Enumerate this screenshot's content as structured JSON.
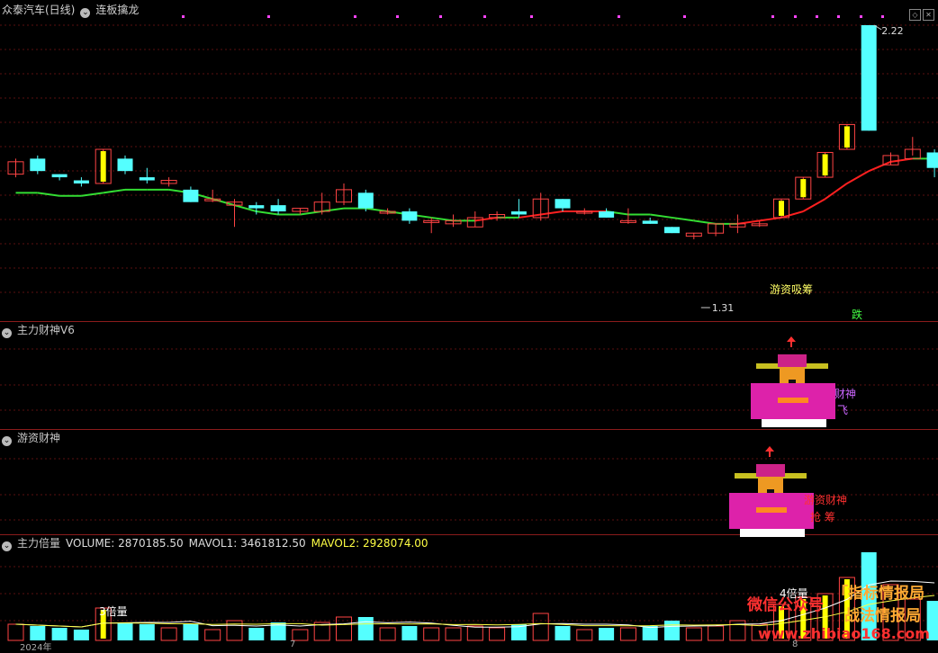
{
  "header": {
    "stock": "众泰汽车(日线)",
    "indicator": "连板擒龙"
  },
  "main": {
    "high_label": "2.22",
    "low_label": "1.31",
    "annotation": "游资吸筹",
    "fall_label": "跌"
  },
  "panel2": {
    "title": "主力财神V6",
    "label_a": "财神",
    "label_b": "飞"
  },
  "panel3": {
    "title": "游资财神",
    "label_a": "游资财神",
    "label_b": "抢 筹"
  },
  "panel4": {
    "title": "主力倍量",
    "volume": "VOLUME: 2870185.50",
    "mavol1": "MAVOL1: 3461812.50",
    "mavol2": "MAVOL2: 2928074.00",
    "label_a": "3倍量",
    "label_b": "4倍量"
  },
  "axis": {
    "year": "2024年",
    "m1": "7",
    "m2": "8"
  },
  "watermark": {
    "line1": "微信公众号",
    "line2": "「指标情报局",
    "line3": "战法情报局",
    "site": "www.zhibiao168.com"
  },
  "colors": {
    "up": "#ff4444",
    "down": "#54ffff",
    "ma_up": "#ff2020",
    "ma_down": "#33dd33",
    "limit": "#ffff00"
  },
  "chart_data": {
    "type": "candlestick",
    "price_range": [
      1.31,
      2.22
    ],
    "candles": [
      {
        "o": 1.78,
        "c": 1.74,
        "h": 1.79,
        "l": 1.73,
        "d": "up"
      },
      {
        "o": 1.79,
        "c": 1.75,
        "h": 1.8,
        "l": 1.74,
        "d": "down"
      },
      {
        "o": 1.74,
        "c": 1.73,
        "h": 1.74,
        "l": 1.72,
        "d": "down"
      },
      {
        "o": 1.72,
        "c": 1.71,
        "h": 1.73,
        "l": 1.7,
        "d": "down"
      },
      {
        "o": 1.71,
        "c": 1.82,
        "h": 1.82,
        "l": 1.71,
        "d": "limit"
      },
      {
        "o": 1.79,
        "c": 1.75,
        "h": 1.8,
        "l": 1.74,
        "d": "down"
      },
      {
        "o": 1.73,
        "c": 1.72,
        "h": 1.76,
        "l": 1.71,
        "d": "down"
      },
      {
        "o": 1.71,
        "c": 1.72,
        "h": 1.73,
        "l": 1.7,
        "d": "up"
      },
      {
        "o": 1.69,
        "c": 1.65,
        "h": 1.7,
        "l": 1.65,
        "d": "down"
      },
      {
        "o": 1.66,
        "c": 1.66,
        "h": 1.69,
        "l": 1.65,
        "d": "up"
      },
      {
        "o": 1.65,
        "c": 1.64,
        "h": 1.66,
        "l": 1.57,
        "d": "up"
      },
      {
        "o": 1.64,
        "c": 1.63,
        "h": 1.65,
        "l": 1.61,
        "d": "down"
      },
      {
        "o": 1.64,
        "c": 1.62,
        "h": 1.66,
        "l": 1.61,
        "d": "down"
      },
      {
        "o": 1.62,
        "c": 1.63,
        "h": 1.63,
        "l": 1.61,
        "d": "up"
      },
      {
        "o": 1.62,
        "c": 1.65,
        "h": 1.68,
        "l": 1.61,
        "d": "up"
      },
      {
        "o": 1.65,
        "c": 1.69,
        "h": 1.71,
        "l": 1.64,
        "d": "up"
      },
      {
        "o": 1.68,
        "c": 1.63,
        "h": 1.69,
        "l": 1.62,
        "d": "down"
      },
      {
        "o": 1.62,
        "c": 1.62,
        "h": 1.63,
        "l": 1.61,
        "d": "up"
      },
      {
        "o": 1.62,
        "c": 1.59,
        "h": 1.63,
        "l": 1.58,
        "d": "down"
      },
      {
        "o": 1.59,
        "c": 1.59,
        "h": 1.6,
        "l": 1.55,
        "d": "up"
      },
      {
        "o": 1.58,
        "c": 1.59,
        "h": 1.61,
        "l": 1.57,
        "d": "up"
      },
      {
        "o": 1.57,
        "c": 1.6,
        "h": 1.62,
        "l": 1.57,
        "d": "up"
      },
      {
        "o": 1.6,
        "c": 1.61,
        "h": 1.62,
        "l": 1.59,
        "d": "up"
      },
      {
        "o": 1.62,
        "c": 1.61,
        "h": 1.66,
        "l": 1.6,
        "d": "down"
      },
      {
        "o": 1.6,
        "c": 1.66,
        "h": 1.68,
        "l": 1.59,
        "d": "up"
      },
      {
        "o": 1.66,
        "c": 1.63,
        "h": 1.66,
        "l": 1.62,
        "d": "down"
      },
      {
        "o": 1.62,
        "c": 1.62,
        "h": 1.63,
        "l": 1.61,
        "d": "up"
      },
      {
        "o": 1.62,
        "c": 1.6,
        "h": 1.63,
        "l": 1.6,
        "d": "down"
      },
      {
        "o": 1.59,
        "c": 1.59,
        "h": 1.63,
        "l": 1.58,
        "d": "up"
      },
      {
        "o": 1.59,
        "c": 1.58,
        "h": 1.6,
        "l": 1.58,
        "d": "down"
      },
      {
        "o": 1.57,
        "c": 1.55,
        "h": 1.57,
        "l": 1.55,
        "d": "down"
      },
      {
        "o": 1.55,
        "c": 1.54,
        "h": 1.55,
        "l": 1.53,
        "d": "up"
      },
      {
        "o": 1.55,
        "c": 1.58,
        "h": 1.58,
        "l": 1.54,
        "d": "up"
      },
      {
        "o": 1.57,
        "c": 1.58,
        "h": 1.61,
        "l": 1.55,
        "d": "up"
      },
      {
        "o": 1.58,
        "c": 1.58,
        "h": 1.59,
        "l": 1.57,
        "d": "up"
      },
      {
        "o": 1.6,
        "c": 1.66,
        "h": 1.66,
        "l": 1.6,
        "d": "limit"
      },
      {
        "o": 1.66,
        "c": 1.73,
        "h": 1.73,
        "l": 1.66,
        "d": "limit"
      },
      {
        "o": 1.73,
        "c": 1.81,
        "h": 1.81,
        "l": 1.73,
        "d": "limit"
      },
      {
        "o": 1.82,
        "c": 1.9,
        "h": 1.9,
        "l": 1.82,
        "d": "limit"
      },
      {
        "o": 2.22,
        "c": 1.88,
        "h": 2.22,
        "l": 1.88,
        "d": "down"
      },
      {
        "o": 1.77,
        "c": 1.8,
        "h": 1.81,
        "l": 1.77,
        "d": "up"
      },
      {
        "o": 1.79,
        "c": 1.82,
        "h": 1.86,
        "l": 1.8,
        "d": "up"
      },
      {
        "o": 1.81,
        "c": 1.76,
        "h": 1.82,
        "l": 1.73,
        "d": "down"
      }
    ],
    "ma": [
      1.68,
      1.68,
      1.67,
      1.67,
      1.68,
      1.69,
      1.69,
      1.69,
      1.68,
      1.66,
      1.64,
      1.62,
      1.61,
      1.61,
      1.62,
      1.63,
      1.63,
      1.62,
      1.61,
      1.6,
      1.59,
      1.59,
      1.6,
      1.6,
      1.61,
      1.62,
      1.62,
      1.62,
      1.61,
      1.61,
      1.6,
      1.59,
      1.58,
      1.58,
      1.59,
      1.6,
      1.62,
      1.66,
      1.71,
      1.75,
      1.78,
      1.79,
      1.79
    ],
    "volume": [
      0.18,
      0.16,
      0.14,
      0.12,
      0.36,
      0.2,
      0.18,
      0.14,
      0.18,
      0.12,
      0.22,
      0.14,
      0.2,
      0.12,
      0.2,
      0.26,
      0.26,
      0.14,
      0.16,
      0.14,
      0.14,
      0.16,
      0.14,
      0.18,
      0.3,
      0.16,
      0.12,
      0.14,
      0.14,
      0.16,
      0.22,
      0.14,
      0.16,
      0.22,
      0.18,
      0.4,
      0.48,
      0.52,
      0.7,
      0.98,
      0.62,
      0.46,
      0.44
    ]
  }
}
